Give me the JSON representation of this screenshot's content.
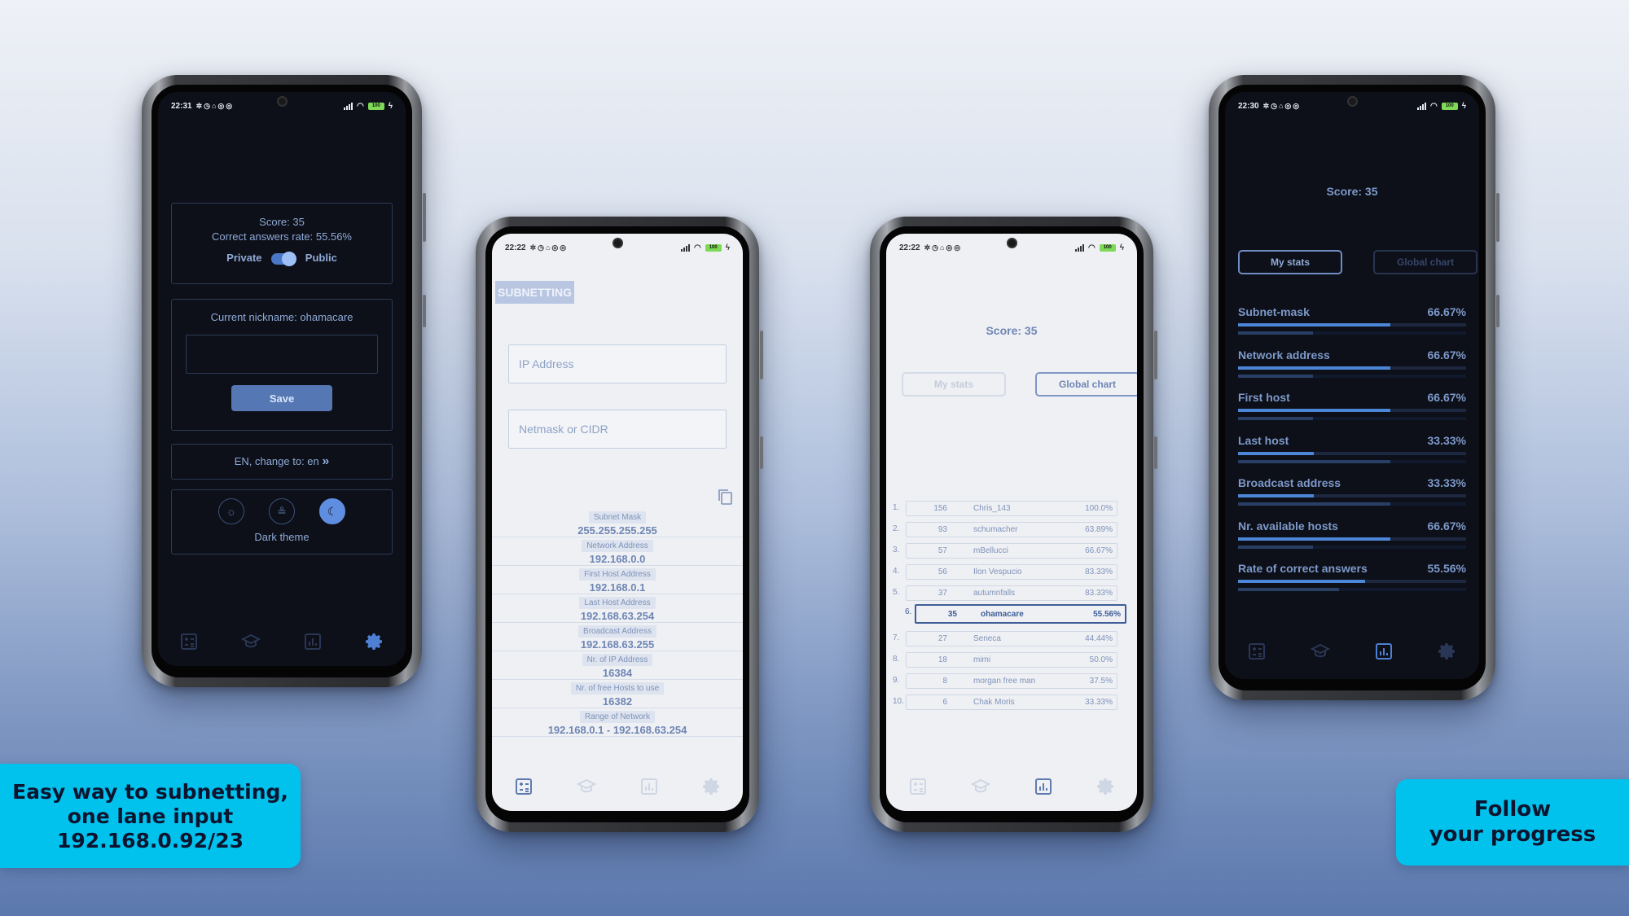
{
  "phone1": {
    "time": "22:31",
    "score": "Score: 35",
    "rate": "Correct answers rate: 55.56%",
    "private_label": "Private",
    "public_label": "Public",
    "nickname": "Current nickname: ohamacare",
    "save_label": "Save",
    "language": "EN, change to:  en",
    "language_icon": "double-chevron-right-icon",
    "theme_label": "Dark theme",
    "theme_icons": [
      "sun-icon",
      "sunset-icon",
      "moon-icon"
    ]
  },
  "phone2": {
    "time": "22:22",
    "title": "SUBNETTING",
    "ip_placeholder": "IP Address",
    "netmask_placeholder": "Netmask or CIDR",
    "results": [
      {
        "label": "Subnet Mask",
        "value": "255.255.255.255"
      },
      {
        "label": "Network Address",
        "value": "192.168.0.0"
      },
      {
        "label": "First Host Address",
        "value": "192.168.0.1"
      },
      {
        "label": "Last Host Address",
        "value": "192.168.63.254"
      },
      {
        "label": "Broadcast Address",
        "value": "192.168.63.255"
      },
      {
        "label": "Nr. of IP Address",
        "value": "16384"
      },
      {
        "label": "Nr. of free Hosts to use",
        "value": "16382"
      },
      {
        "label": "Range of Network",
        "value": "192.168.0.1 - 192.168.63.254"
      }
    ]
  },
  "phone3": {
    "time": "22:22",
    "score": "Score: 35",
    "tab_my_stats": "My stats",
    "tab_global": "Global chart",
    "leaderboard": [
      {
        "rank": "1.",
        "score": "156",
        "name": "Chris_143",
        "rate": "100.0%"
      },
      {
        "rank": "2.",
        "score": "93",
        "name": "schumacher",
        "rate": "63.89%"
      },
      {
        "rank": "3.",
        "score": "57",
        "name": "mBellucci",
        "rate": "66.67%"
      },
      {
        "rank": "4.",
        "score": "56",
        "name": "Ilon Vespucio",
        "rate": "83.33%"
      },
      {
        "rank": "5.",
        "score": "37",
        "name": "autumnfalls",
        "rate": "83.33%"
      },
      {
        "rank": "6.",
        "score": "35",
        "name": "ohamacare",
        "rate": "55.56%"
      },
      {
        "rank": "7.",
        "score": "27",
        "name": "Seneca",
        "rate": "44.44%"
      },
      {
        "rank": "8.",
        "score": "18",
        "name": "mimi",
        "rate": "50.0%"
      },
      {
        "rank": "9.",
        "score": "8",
        "name": "morgan free man",
        "rate": "37.5%"
      },
      {
        "rank": "10.",
        "score": "6",
        "name": "Chak Moris",
        "rate": "33.33%"
      }
    ]
  },
  "phone4": {
    "time": "22:30",
    "score": "Score: 35",
    "tab_my_stats": "My stats",
    "tab_global": "Global chart",
    "stats": [
      {
        "label": "Subnet-mask",
        "value": "66.67%",
        "fill": 0.6667,
        "secondary": 0.33
      },
      {
        "label": "Network address",
        "value": "66.67%",
        "fill": 0.6667,
        "secondary": 0.33
      },
      {
        "label": "First host",
        "value": "66.67%",
        "fill": 0.6667,
        "secondary": 0.33
      },
      {
        "label": "Last host",
        "value": "33.33%",
        "fill": 0.3333,
        "secondary": 0.6667
      },
      {
        "label": "Broadcast address",
        "value": "33.33%",
        "fill": 0.3333,
        "secondary": 0.6667
      },
      {
        "label": "Nr. available hosts",
        "value": "66.67%",
        "fill": 0.6667,
        "secondary": 0.33
      },
      {
        "label": "Rate of correct answers",
        "value": "55.56%",
        "fill": 0.5556,
        "secondary": 0.4444
      }
    ]
  },
  "captions": {
    "left": [
      "Easy way to subnetting,",
      "one lane input",
      "192.168.0.92/23"
    ],
    "right": [
      "Follow",
      "your progress"
    ]
  },
  "nav_icons": [
    "calculator-icon",
    "graduation-cap-icon",
    "bar-chart-icon",
    "gear-icon"
  ],
  "colors": {
    "accent": "#4c86d8",
    "caption_bg": "#00c2ec",
    "dark_bg": "#0d1019",
    "light_bg": "#eef0f4"
  }
}
